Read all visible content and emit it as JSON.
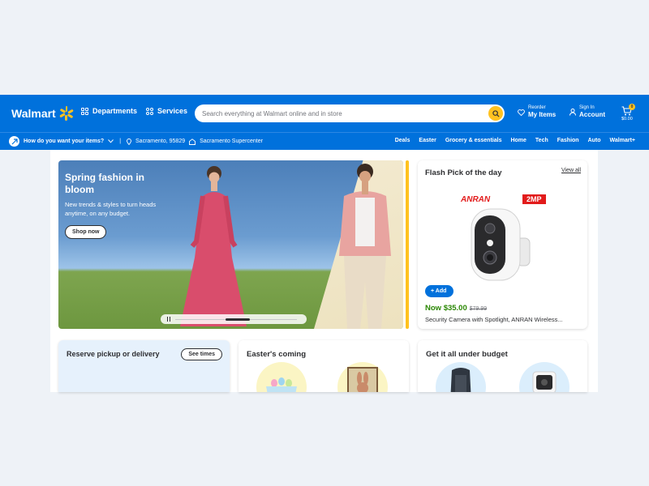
{
  "header": {
    "logo_text": "Walmart",
    "departments_label": "Departments",
    "services_label": "Services",
    "search_placeholder": "Search everything at Walmart online and in store",
    "reorder_small": "Reorder",
    "reorder_big": "My Items",
    "signin_small": "Sign In",
    "signin_big": "Account",
    "cart_count": "0",
    "cart_total": "$0.00",
    "accent_color": "#0071dc",
    "spark_color": "#ffc220"
  },
  "subnav": {
    "delivery_prompt": "How do you want your items?",
    "location": "Sacramento, 95829",
    "store": "Sacramento Supercenter",
    "links": [
      "Deals",
      "Easter",
      "Grocery & essentials",
      "Home",
      "Tech",
      "Fashion",
      "Auto",
      "Walmart+"
    ]
  },
  "hero": {
    "title": "Spring fashion in bloom",
    "subtitle": "New trends & styles to turn heads anytime, on any budget.",
    "cta": "Shop now"
  },
  "flash": {
    "title": "Flash Pick of the day",
    "view_all": "View all",
    "brand": "ANRAN",
    "badge": "2MP",
    "add_label": "Add",
    "price_now": "Now $35.00",
    "price_was": "$79.99",
    "product_title": "Security Camera with Spotlight, ANRAN Wireless..."
  },
  "tiles": {
    "reserve_title": "Reserve pickup or delivery",
    "reserve_button": "See times",
    "easter_title": "Easter's coming",
    "budget_title": "Get it all under budget"
  },
  "icons": [
    "spark-logo",
    "grid-icon",
    "services-icon",
    "search-icon",
    "heart-icon",
    "user-icon",
    "cart-icon",
    "delivery-icon",
    "chevron-down-icon",
    "location-pin-icon",
    "store-icon",
    "pause-icon",
    "plus-icon"
  ]
}
